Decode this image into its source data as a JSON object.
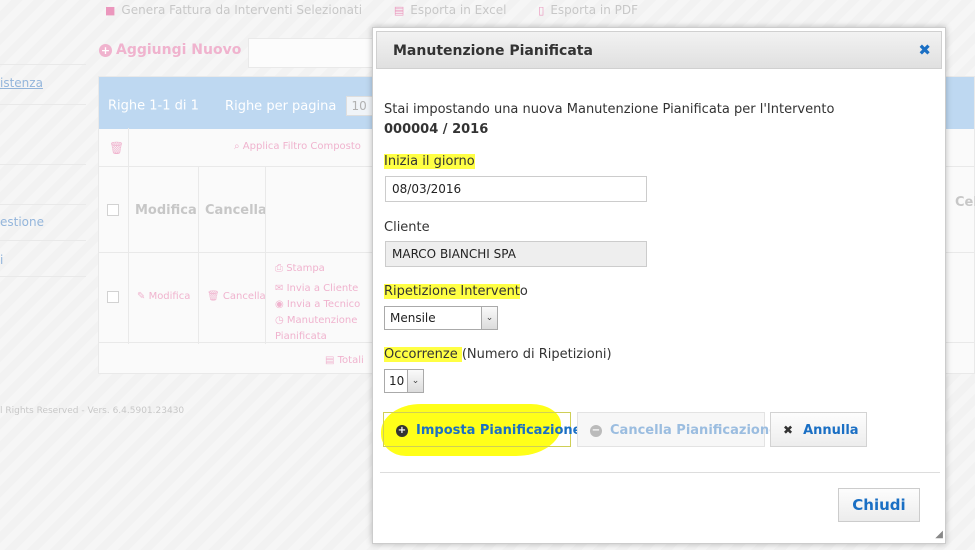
{
  "background": {
    "top_actions": [
      "Genera Fattura da Interventi Selezionati",
      "Esporta in Excel",
      "Esporta in PDF"
    ],
    "add_new": "Aggiungi Nuovo",
    "side_links": [
      "istenza",
      "estione",
      "i"
    ],
    "grid": {
      "rows_info": "Righe 1-1 di 1",
      "rows_per_page_label": "Righe per pagina",
      "rows_per_page_value": "10",
      "apply_filter": "Applica Filtro Composto",
      "col_modifica": "Modifica",
      "col_cancella": "Cancella",
      "col_cel": "Cel",
      "row_modifica": "Modifica",
      "row_cancella": "Cancella",
      "row_actions": [
        "Stampa",
        "Invia a Cliente",
        "Invia a Tecnico",
        "Manutenzione Pianificata"
      ],
      "totali": "Totali"
    },
    "footer": "l Rights Reserved - Vers. 6.4.5901.23430"
  },
  "dialog": {
    "title": "Manutenzione Pianificata",
    "intro": "Stai impostando una nuova Manutenzione Pianificata per l'Intervento",
    "intervention_number": "000004 / 2016",
    "start_label": "Inizia il giorno",
    "start_value": "08/03/2016",
    "client_label": "Cliente",
    "client_value": "MARCO BIANCHI SPA",
    "repeat_label_hl": "Ripetizione Intervent",
    "repeat_label_rest": "o",
    "repeat_value": "Mensile",
    "occ_label_hl": "Occorrenze ",
    "occ_label_rest": "(Numero di Ripetizioni)",
    "occ_value": "10",
    "btn_set": "Imposta Pianificazione",
    "btn_cancel_plan": "Cancella Pianificazione",
    "btn_annulla": "Annulla",
    "btn_close": "Chiudi"
  },
  "colors": {
    "accent_blue": "#1a6fc4",
    "highlight_yellow": "#ffff44",
    "brand_pink": "#e0609a",
    "grid_header": "#9cc4ea"
  }
}
